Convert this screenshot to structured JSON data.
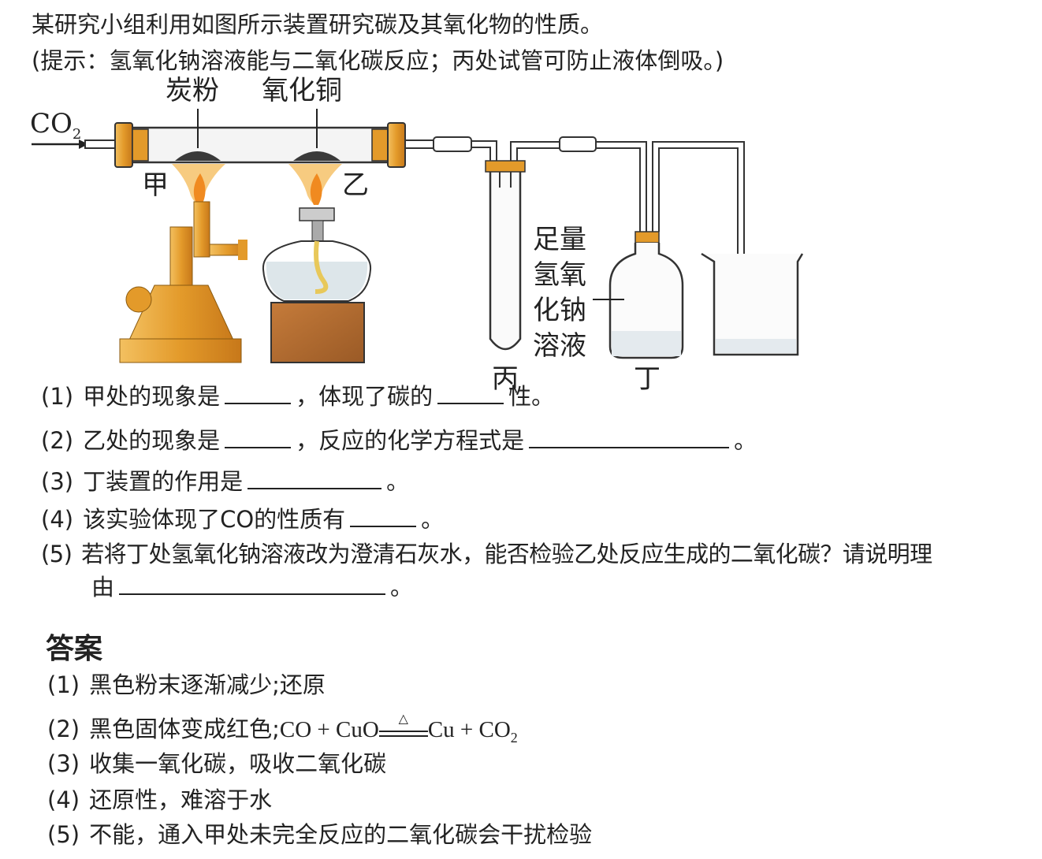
{
  "question": {
    "intro": "某研究小组利用如图所示装置研究碳及其氧化物的性质。",
    "hint": "(提示：氢氧化钠溶液能与二氧化碳反应；丙处试管可防止液体倒吸。)",
    "q1": {
      "num": "(1)",
      "a": "甲处的现象是",
      "b": "，体现了碳的",
      "c": "性。"
    },
    "q2": {
      "num": "(2)",
      "a": "乙处的现象是",
      "b": "，反应的化学方程式是",
      "c": "。"
    },
    "q3": {
      "num": "(3)",
      "a": "丁装置的作用是",
      "c": "。"
    },
    "q4": {
      "num": "(4)",
      "a": "该实验体现了CO的性质有",
      "c": "。"
    },
    "q5": {
      "num": "(5)",
      "a": "若将丁处氢氧化钠溶液改为澄清石灰水，能否检验乙处反应生成的二氧化碳？请说明理",
      "b": "由",
      "c": "。"
    }
  },
  "diagram": {
    "co2_label": "CO",
    "co2_sub": "2",
    "carbon_label": "炭粉",
    "cuo_label": "氧化铜",
    "jia": "甲",
    "yi": "乙",
    "bing": "丙",
    "ding": "丁",
    "naoh_lines": [
      "足量",
      "氢氧",
      "化钠",
      "溶液"
    ]
  },
  "answer": {
    "title": "答案",
    "a1": {
      "num": "(1)",
      "text": "黑色粉末逐渐减少;还原"
    },
    "a2": {
      "num": "(2)",
      "text": "黑色固体变成红色;",
      "eq_left": "CO + CuO",
      "cond": "△",
      "eq_right": "Cu + CO",
      "sub": "2"
    },
    "a3": {
      "num": "(3)",
      "text": "收集一氧化碳，吸收二氧化碳"
    },
    "a4": {
      "num": "(4)",
      "text": "还原性，难溶于水"
    },
    "a5": {
      "num": "(5)",
      "text": "不能，通入甲处未完全反应的二氧化碳会干扰检验"
    }
  },
  "colors": {
    "burner": "#e8a030",
    "flame": "#f5b040",
    "box": "#b06a30",
    "tube": "#333333"
  }
}
